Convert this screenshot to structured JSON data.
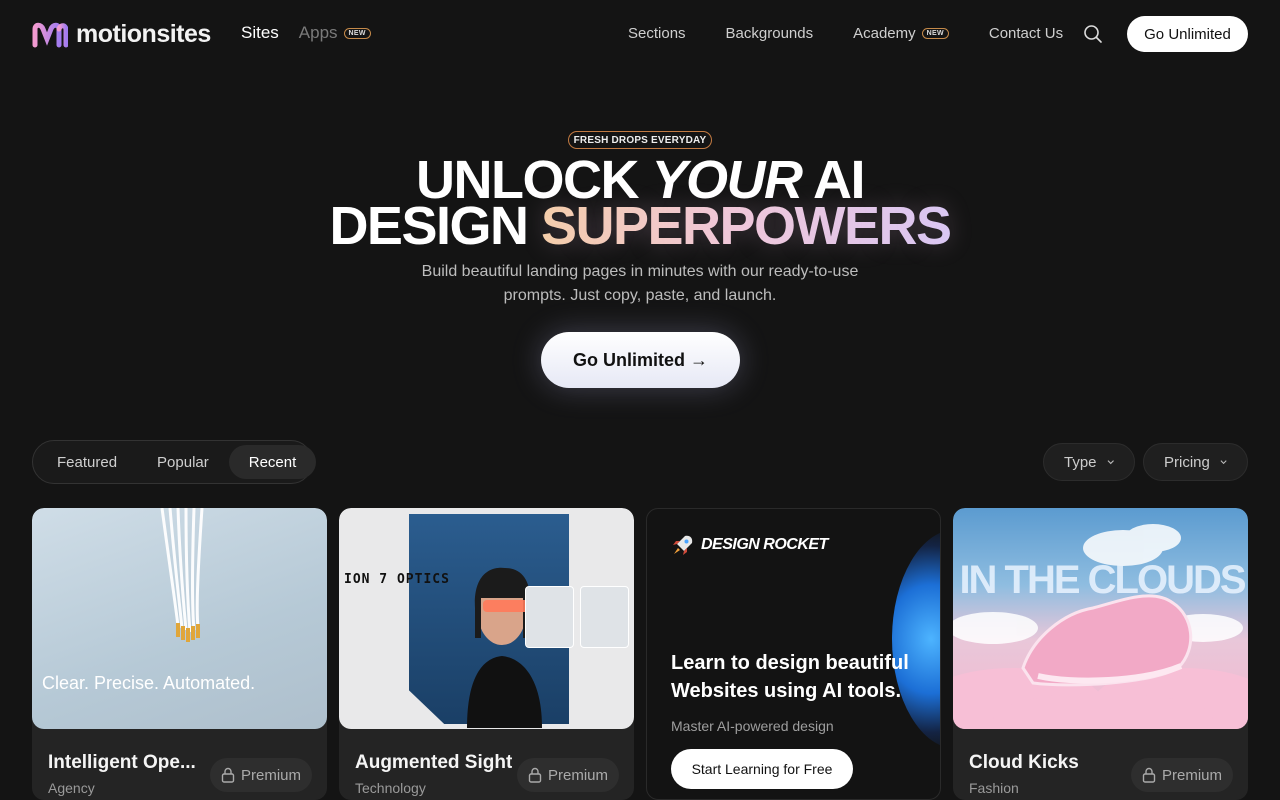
{
  "brand": {
    "name": "motionsites"
  },
  "nav": {
    "sites": "Sites",
    "apps": "Apps",
    "new_badge": "NEW",
    "links": [
      "Sections",
      "Backgrounds",
      "Academy",
      "Contact Us"
    ],
    "cta": "Go Unlimited"
  },
  "hero": {
    "badge": "FRESH DROPS EVERYDAY",
    "line1_a": "UNLOCK ",
    "line1_b": "YOUR",
    "line1_c": " AI",
    "line2_a": "DESIGN ",
    "line2_b": "SUPERPOWERS",
    "subtitle": "Build beautiful landing pages in minutes with our ready-to-use prompts. Just copy, paste, and launch.",
    "cta": "Go Unlimited →"
  },
  "filters": {
    "tabs": [
      "Featured",
      "Popular",
      "Recent"
    ],
    "active_tab": "Recent",
    "type": "Type",
    "pricing": "Pricing"
  },
  "cards": [
    {
      "title": "Intelligent Ope...",
      "category": "Agency",
      "badge": "Premium",
      "thumb_text": "Clear. Precise. Automated."
    },
    {
      "title": "Augmented Sight",
      "category": "Technology",
      "badge": "Premium",
      "thumb_text": "ION 7 OPTICS"
    },
    {
      "brand": "DESIGN ROCKET",
      "heading": "Learn to design beautiful Websites using AI tools.",
      "subtitle": "Master AI-powered design",
      "cta": "Start Learning for Free"
    },
    {
      "title": "Cloud Kicks",
      "category": "Fashion",
      "badge": "Premium",
      "thumb_text": "IN THE CLOUDS"
    }
  ],
  "colors": {
    "background": "#141414",
    "accent_badge": "#c27a42"
  }
}
